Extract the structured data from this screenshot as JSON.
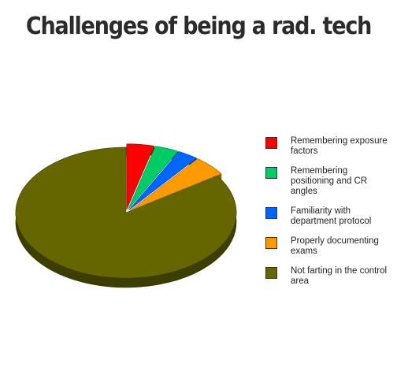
{
  "chart_data": {
    "type": "pie",
    "title": "Challenges of being a rad. tech",
    "legend_position": "right",
    "slices": [
      {
        "label": "Remembering exposure factors",
        "value": 4,
        "color": "#ff0000",
        "exploded": true
      },
      {
        "label": "Remembering positioning and CR angles",
        "value": 3.5,
        "color": "#00cc66",
        "exploded": true
      },
      {
        "label": "Familiarity with department protocol",
        "value": 3,
        "color": "#0066ff",
        "exploded": true
      },
      {
        "label": "Properly documenting exams",
        "value": 5,
        "color": "#ff9900",
        "exploded": true
      },
      {
        "label": "Not farting in the control area",
        "value": 84.5,
        "color": "#666600",
        "exploded": false
      }
    ]
  }
}
